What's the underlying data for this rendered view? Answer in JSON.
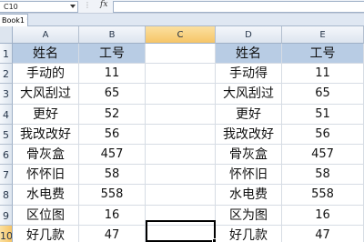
{
  "formula_bar": {
    "name_box": "C10",
    "fx_label": "fx",
    "dots": "⋮",
    "formula": ""
  },
  "workbook_tab": "Book1 *",
  "columns": [
    "A",
    "B",
    "C",
    "D",
    "E"
  ],
  "selected_column": "C",
  "rows": [
    "1",
    "2",
    "3",
    "4",
    "5",
    "6",
    "7",
    "8",
    "9",
    "10"
  ],
  "selected_row": "10",
  "active_cell": "C10",
  "table_left": {
    "headers": [
      "姓名",
      "工号"
    ],
    "rows": [
      [
        "手动的",
        "11"
      ],
      [
        "大风刮过",
        "65"
      ],
      [
        "更好",
        "52"
      ],
      [
        "我改改好",
        "56"
      ],
      [
        "骨灰盒",
        "457"
      ],
      [
        "怀怀旧",
        "58"
      ],
      [
        "水电费",
        "558"
      ],
      [
        "区位图",
        "16"
      ],
      [
        "好几款",
        "47"
      ]
    ]
  },
  "table_right": {
    "headers": [
      "姓名",
      "工号"
    ],
    "rows": [
      [
        "手动得",
        "11"
      ],
      [
        "大风刮过",
        "65"
      ],
      [
        "更好",
        "51"
      ],
      [
        "我改改好",
        "56"
      ],
      [
        "骨灰盒",
        "457"
      ],
      [
        "怀怀旧",
        "58"
      ],
      [
        "水电费",
        "558"
      ],
      [
        "区为图",
        "16"
      ],
      [
        "好几款",
        "47"
      ]
    ]
  },
  "colors": {
    "header_fill": "#b8cce4",
    "selected_header": "#f6c567",
    "grid_line": "#d6dce4"
  }
}
